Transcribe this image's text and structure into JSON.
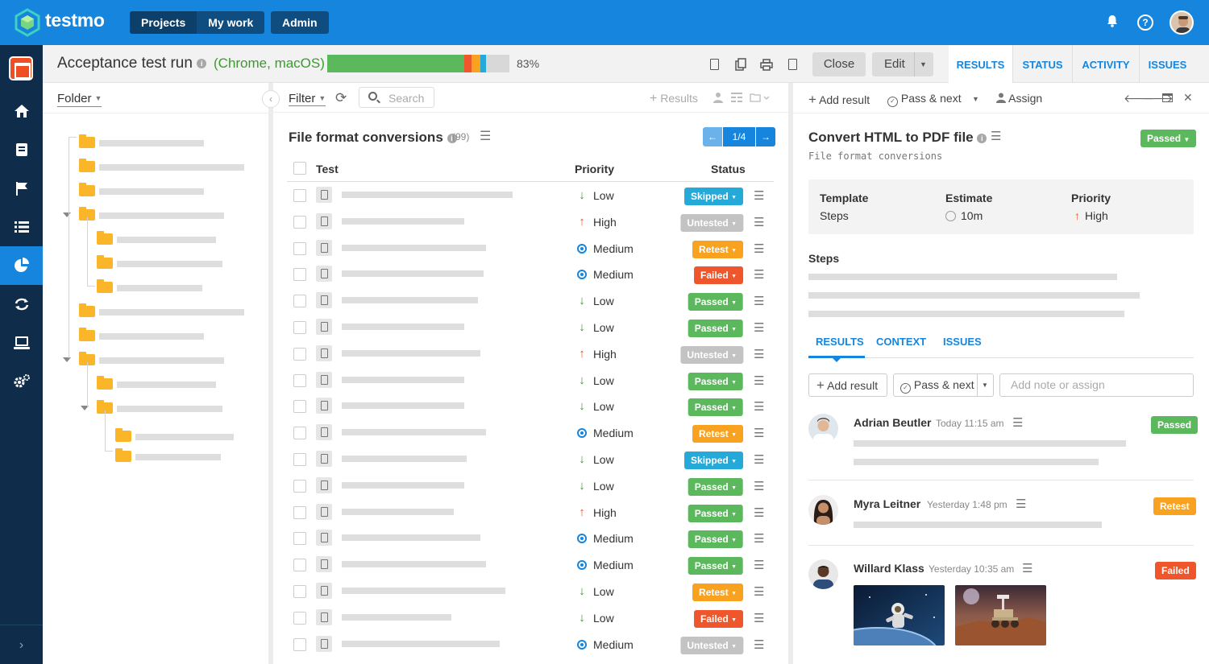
{
  "app": {
    "name": "testmo",
    "nav": [
      "Projects",
      "My work"
    ],
    "admin": "Admin"
  },
  "run": {
    "title": "Acceptance test run",
    "config": "(Chrome, macOS)",
    "progress_pct": "83%",
    "progress_segments": [
      {
        "status": "Passed",
        "fraction": 0.75,
        "color": "#5cb85c"
      },
      {
        "status": "Failed",
        "fraction": 0.04,
        "color": "#f0562b"
      },
      {
        "status": "Retest",
        "fraction": 0.05,
        "color": "#f8a21f"
      },
      {
        "status": "Skipped",
        "fraction": 0.03,
        "color": "#25a9d8"
      },
      {
        "status": "Untested",
        "fraction": 0.13,
        "color": "#d8d8d8"
      }
    ],
    "close_label": "Close",
    "edit_label": "Edit",
    "tabs": [
      "RESULTS",
      "STATUS",
      "ACTIVITY",
      "ISSUES"
    ]
  },
  "tree": {
    "label": "Folder"
  },
  "list": {
    "filter_label": "Filter",
    "search_placeholder": "Search",
    "results_label": "Results",
    "title": "File format conversions",
    "count": "(99)",
    "pager": "1/4",
    "col_test": "Test",
    "col_priority": "Priority",
    "col_status": "Status",
    "rows": [
      {
        "priority": "Low",
        "status": "Skipped"
      },
      {
        "priority": "High",
        "status": "Untested"
      },
      {
        "priority": "Medium",
        "status": "Retest"
      },
      {
        "priority": "Medium",
        "status": "Failed"
      },
      {
        "priority": "Low",
        "status": "Passed"
      },
      {
        "priority": "Low",
        "status": "Passed"
      },
      {
        "priority": "High",
        "status": "Untested"
      },
      {
        "priority": "Low",
        "status": "Passed"
      },
      {
        "priority": "Low",
        "status": "Passed"
      },
      {
        "priority": "Medium",
        "status": "Retest"
      },
      {
        "priority": "Low",
        "status": "Skipped"
      },
      {
        "priority": "Low",
        "status": "Passed"
      },
      {
        "priority": "High",
        "status": "Passed"
      },
      {
        "priority": "Medium",
        "status": "Passed"
      },
      {
        "priority": "Medium",
        "status": "Passed"
      },
      {
        "priority": "Low",
        "status": "Retest"
      },
      {
        "priority": "Low",
        "status": "Failed"
      },
      {
        "priority": "Medium",
        "status": "Untested"
      }
    ]
  },
  "detail": {
    "add_result": "Add result",
    "pass_next": "Pass & next",
    "assign": "Assign",
    "title": "Convert HTML to PDF file",
    "folder": "File format conversions",
    "status": "Passed",
    "template_label": "Template",
    "template_value": "Steps",
    "estimate_label": "Estimate",
    "estimate_value": "10m",
    "priority_label": "Priority",
    "priority_value": "High",
    "steps_label": "Steps",
    "subtabs": [
      "RESULTS",
      "CONTEXT",
      "ISSUES"
    ],
    "note_placeholder": "Add note or assign",
    "results": [
      {
        "name": "Adrian Beutler",
        "time": "Today 11:15 am",
        "status": "Passed"
      },
      {
        "name": "Myra Leitner",
        "time": "Yesterday 1:48 pm",
        "status": "Retest"
      },
      {
        "name": "Willard Klass",
        "time": "Yesterday 10:35 am",
        "status": "Failed"
      }
    ]
  },
  "colors": {
    "Passed": "#5cb85c",
    "Failed": "#f0562b",
    "Retest": "#f8a21f",
    "Skipped": "#25a9d8",
    "Untested": "#c3c3c3",
    "accent": "#1585dd",
    "sidebar": "#0f2d4a"
  },
  "icons": [
    "bell-icon",
    "help-icon",
    "home-icon",
    "book-icon",
    "flag-icon",
    "list-icon",
    "pie-chart-icon",
    "sync-icon",
    "monitor-icon",
    "gear-icon"
  ]
}
